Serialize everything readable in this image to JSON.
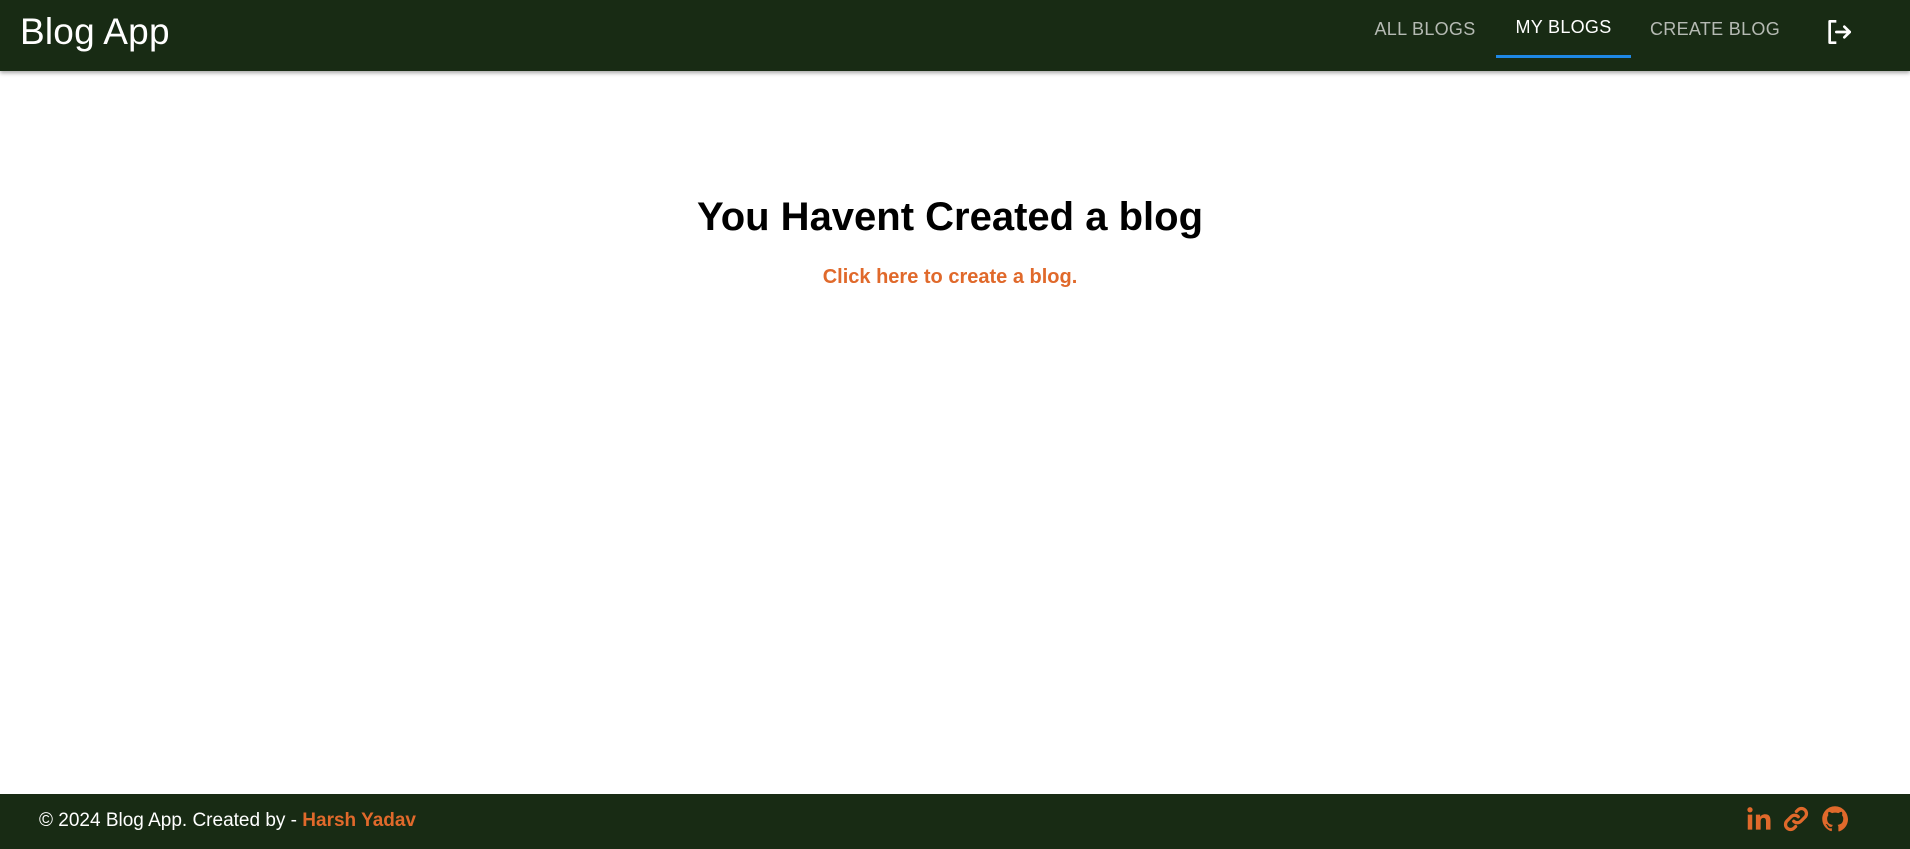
{
  "header": {
    "brand": "Blog App",
    "tabs": [
      {
        "label": "ALL BLOGS",
        "active": false
      },
      {
        "label": "MY BLOGS",
        "active": true
      },
      {
        "label": "CREATE BLOG",
        "active": false
      }
    ],
    "logout_icon": "logout-icon"
  },
  "main": {
    "heading": "You Havent Created a blog",
    "create_link": "Click here to create a blog."
  },
  "footer": {
    "copyright": "© 2024 Blog App. Created by - ",
    "author": "Harsh Yadav",
    "social_icons": [
      "linkedin-icon",
      "link-icon",
      "github-icon"
    ]
  },
  "colors": {
    "header_bg": "#182b14",
    "accent": "#e0692b",
    "active_indicator": "#1e88e5",
    "inactive_tab": "#b5bab3"
  }
}
